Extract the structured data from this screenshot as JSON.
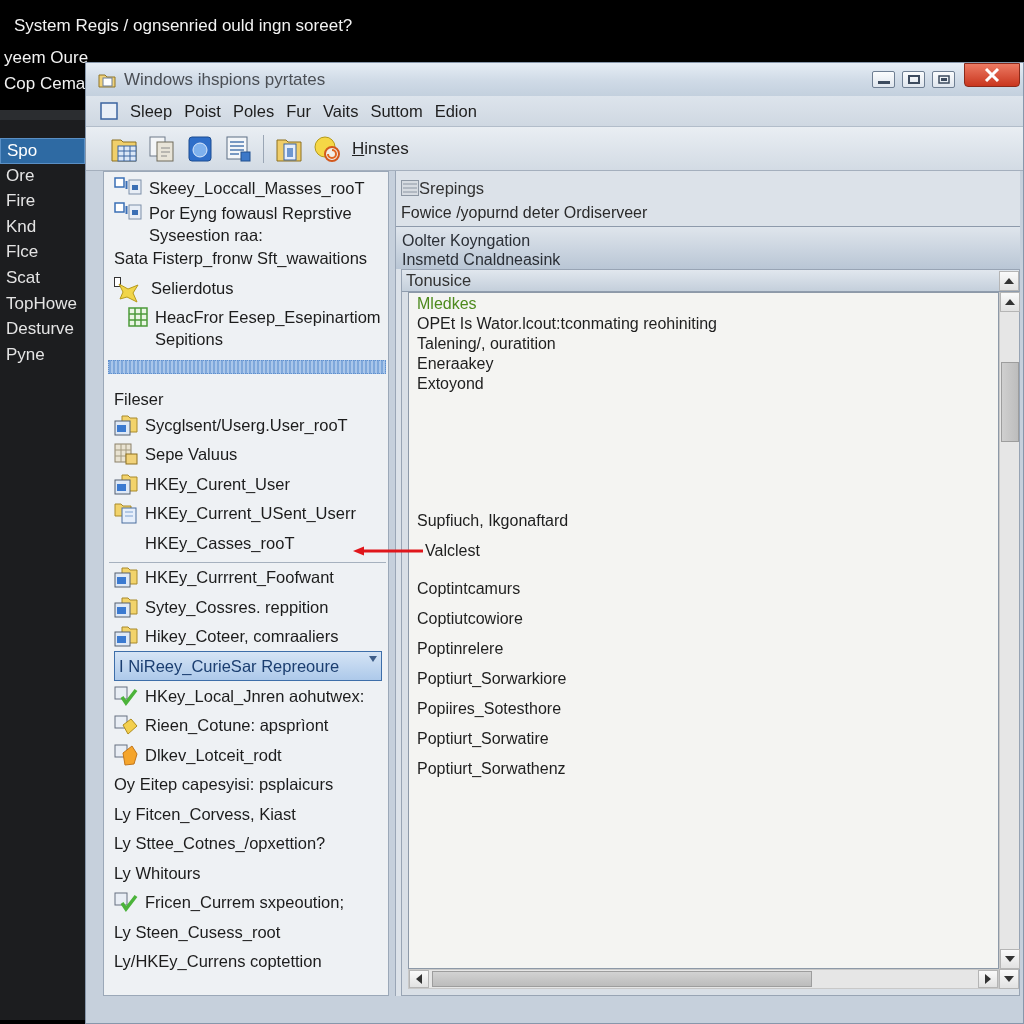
{
  "desktop": {
    "heading": "System Regis / ognsenried ould ingn soreet?",
    "lines": [
      "yeem Oure",
      "Cop Cema"
    ],
    "sidebar": [
      {
        "label": "Spo",
        "selected": true
      },
      {
        "label": "Ore",
        "selected": false
      },
      {
        "label": "Fire",
        "selected": false
      },
      {
        "label": "Knd",
        "selected": false
      },
      {
        "label": "Flce",
        "selected": false
      },
      {
        "label": "Scat",
        "selected": false
      },
      {
        "label": "TopHowe",
        "selected": false
      },
      {
        "label": "Desturve",
        "selected": false
      },
      {
        "label": "Pyne",
        "selected": false
      }
    ]
  },
  "window": {
    "title": "Windows ihspions pyrtates",
    "menu": [
      "Sleep",
      "Poist",
      "Poles",
      "Fur",
      "Vaits",
      "Suttom",
      "Edion"
    ],
    "toolbar": {
      "label": "Hinstes"
    },
    "tree": {
      "sections": [
        {
          "kind": "plain",
          "items": [
            {
              "kind": "keys",
              "label": "Skeey_Loccall_Masses_rooT",
              "selected": false
            },
            {
              "kind": "keys",
              "label": "Por Eyng fowausl Reprstive",
              "continuation": "Syseestion raa:",
              "selected": false
            },
            {
              "kind": "plain",
              "label": "Sata Fisterp_fronw Sft_wawaitions",
              "selected": false
            },
            {
              "kind": "star",
              "label": "Selierdotus",
              "selected": false
            },
            {
              "kind": "table",
              "label": "HeacFror Eesep_Esepinartiom",
              "continuation": "Sepitions",
              "selected": false
            }
          ]
        },
        {
          "kind": "banded",
          "heading": "Fileser",
          "items": [
            {
              "kind": "folder",
              "label": "Sycglsent/Userg.User_rooT",
              "selected": false
            },
            {
              "kind": "values",
              "label": "Sepe Valuus",
              "selected": false
            },
            {
              "kind": "folder",
              "label": "HKEy_Curent_User",
              "selected": false
            },
            {
              "kind": "document",
              "label": "HKEy_Current_USent_Userr",
              "selected": false
            },
            {
              "kind": "blank",
              "label": "HKEy_Casses_rooT",
              "selected": false
            }
          ]
        },
        {
          "kind": "ruled",
          "items": [
            {
              "kind": "folder",
              "label": "HKEy_Currrent_Foofwant",
              "selected": false
            },
            {
              "kind": "folder",
              "label": "Sytey_Cossres. reppition",
              "selected": false
            },
            {
              "kind": "folder",
              "label": "Hikey_Coteer, comraaliers",
              "selected": false
            },
            {
              "kind": "plain",
              "label": "I NiReey_CurieSar Repreoure",
              "selected": true
            },
            {
              "kind": "check",
              "label": "HKey_Local_Jnren aohutwex:",
              "selected": false
            },
            {
              "kind": "note",
              "label": "Rieen_Cotune: apsprìont",
              "selected": false
            },
            {
              "kind": "tag",
              "label": "Dlkev_Lotceit_rodt",
              "selected": false
            },
            {
              "kind": "plain",
              "label": "Oy Eitep capesyisi: psplaicurs",
              "selected": false
            },
            {
              "kind": "plain",
              "label": "Ly Fitcen_Corvess, Kiast",
              "selected": false
            },
            {
              "kind": "plain",
              "label": "Ly Sttee_Cotnes_/opxettion?",
              "selected": false
            },
            {
              "kind": "plain",
              "label": "Ly Whitours",
              "selected": false
            },
            {
              "kind": "check",
              "label": "Fricen_Currem sxpeoution;",
              "selected": false
            },
            {
              "kind": "plain",
              "label": "Ly Steen_Cusess_root",
              "selected": false
            },
            {
              "kind": "plain",
              "label": "Ly/HKEy_Currens coptettion",
              "selected": false
            }
          ]
        }
      ]
    },
    "details": {
      "heading": "Srepings",
      "path": "Fowice /yopurnd deter Ordiserveer",
      "group": [
        "Oolter Koyngation",
        "Insmetd Cnaldneasink"
      ],
      "list": {
        "title": "Tonusice",
        "sections": [
          {
            "lines": [
              {
                "kind": "accent",
                "text": "Mledkes"
              },
              {
                "kind": "normal",
                "text": "OPEt Is Wator.lcout:tconmating reohiniting"
              },
              {
                "kind": "normal",
                "text": "Talening/, ouratition"
              },
              {
                "kind": "normal",
                "text": "Eneraakey"
              },
              {
                "kind": "normal",
                "text": "Extoyond"
              }
            ]
          },
          {
            "lines": [
              {
                "kind": "normal",
                "text": "Supfiuch, Ikgonaftard"
              },
              {
                "kind": "pointed",
                "text": "Valclest"
              },
              {
                "kind": "normal",
                "text": "Coptintcamurs"
              },
              {
                "kind": "normal",
                "text": "Coptiutcowiore"
              },
              {
                "kind": "normal",
                "text": "Poptinrelere"
              },
              {
                "kind": "normal",
                "text": "Poptiurt_Sorwarkiore"
              },
              {
                "kind": "normal",
                "text": "Popiires_Sotesthore"
              },
              {
                "kind": "normal",
                "text": "Poptiurt_Sorwatire"
              },
              {
                "kind": "normal",
                "text": "Poptiurt_Sorwathenz"
              }
            ]
          }
        ]
      }
    }
  }
}
